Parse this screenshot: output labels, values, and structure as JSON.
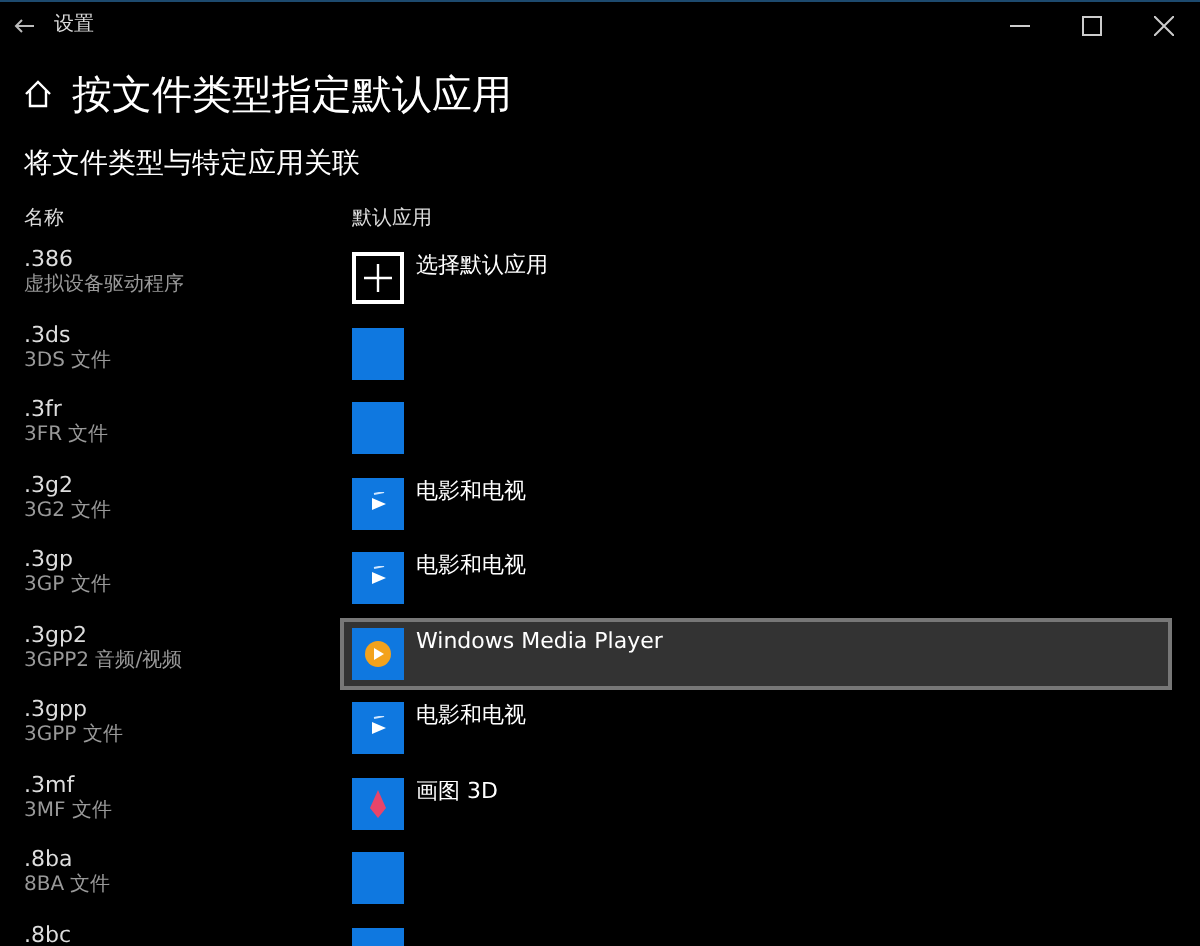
{
  "window": {
    "title": "设置"
  },
  "page": {
    "title": "按文件类型指定默认应用",
    "subtitle": "将文件类型与特定应用关联"
  },
  "columns": [
    "名称",
    "默认应用"
  ],
  "rows": [
    {
      "extension": ".386",
      "description": "虚拟设备驱动程序",
      "app": {
        "kind": "add",
        "name": "选择默认应用"
      },
      "selected": false
    },
    {
      "extension": ".3ds",
      "description": "3DS 文件",
      "app": {
        "kind": "blank"
      },
      "selected": false
    },
    {
      "extension": ".3fr",
      "description": "3FR 文件",
      "app": {
        "kind": "blank"
      },
      "selected": false
    },
    {
      "extension": ".3g2",
      "description": "3G2 文件",
      "app": {
        "kind": "movies",
        "name": "电影和电视"
      },
      "selected": false
    },
    {
      "extension": ".3gp",
      "description": "3GP 文件",
      "app": {
        "kind": "movies",
        "name": "电影和电视"
      },
      "selected": false
    },
    {
      "extension": ".3gp2",
      "description": "3GPP2 音频/视频",
      "app": {
        "kind": "mediaplayer",
        "name": "Windows Media Player"
      },
      "selected": true
    },
    {
      "extension": ".3gpp",
      "description": "3GPP 文件",
      "app": {
        "kind": "movies",
        "name": "电影和电视"
      },
      "selected": false
    },
    {
      "extension": ".3mf",
      "description": "3MF 文件",
      "app": {
        "kind": "paint3d",
        "name": "画图 3D"
      },
      "selected": false
    },
    {
      "extension": ".8ba",
      "description": "8BA 文件",
      "app": {
        "kind": "blank"
      },
      "selected": false
    },
    {
      "extension": ".8bc",
      "app": {
        "kind": "blank"
      },
      "selected": false
    }
  ]
}
